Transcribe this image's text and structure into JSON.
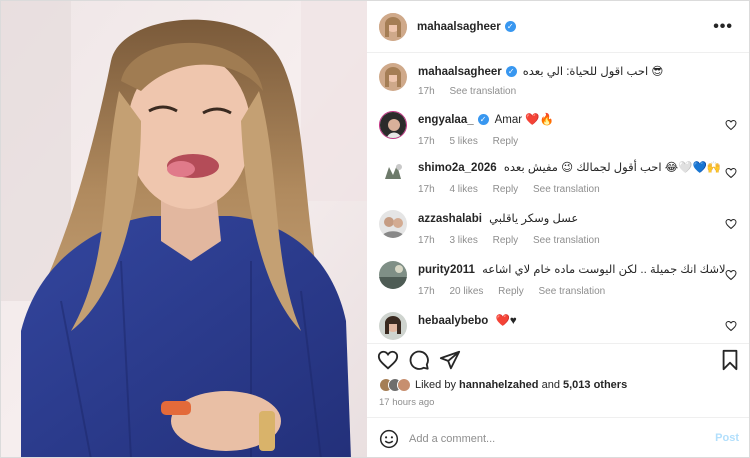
{
  "post": {
    "username": "mahaalsagheer",
    "verified_mark": "✓",
    "more_icon": "•••"
  },
  "caption": {
    "username": "mahaalsagheer",
    "text": "احب اقول للحياة: الي بعده 😎",
    "time": "17h",
    "see_translation": "See translation"
  },
  "comments": [
    {
      "username": "engyalaa_",
      "text": "Amar ❤️🔥",
      "time": "17h",
      "likes": "5 likes",
      "reply": "Reply",
      "translation": ""
    },
    {
      "username": "shimo2a_2026",
      "text": "احب أقول لجمالك 😉 مفيش بعده 😂🤍💙🙌",
      "time": "17h",
      "likes": "4 likes",
      "reply": "Reply",
      "translation": "See translation"
    },
    {
      "username": "azzashalabi",
      "text": "عسل وسكر ياقلبي",
      "time": "17h",
      "likes": "3 likes",
      "reply": "Reply",
      "translation": "See translation"
    },
    {
      "username": "purity2011",
      "text": "لاشك انك جميلة .. لكن اليوست ماده خام لاي اشاعه",
      "time": "17h",
      "likes": "20 likes",
      "reply": "Reply",
      "translation": "See translation"
    },
    {
      "username": "hebaalybebo",
      "text": "❤️♥",
      "time": "",
      "likes": "",
      "reply": "",
      "translation": ""
    }
  ],
  "likes": {
    "prefix": "Liked by",
    "user": "hannahelzahed",
    "middle": "and",
    "others": "5,013 others"
  },
  "timestamp": "17 hours ago",
  "add_comment": {
    "placeholder": "Add a comment...",
    "post_label": "Post"
  },
  "colors": {
    "accent": "#3897f0",
    "heart": "#ed4956",
    "muted": "#8e8e8e",
    "post_disabled": "#b2dffc",
    "shirt": "#2e3f94"
  },
  "icons": [
    "heart-icon",
    "comment-icon",
    "share-icon",
    "bookmark-icon",
    "emoji-icon",
    "more-icon",
    "verified-badge-icon"
  ]
}
